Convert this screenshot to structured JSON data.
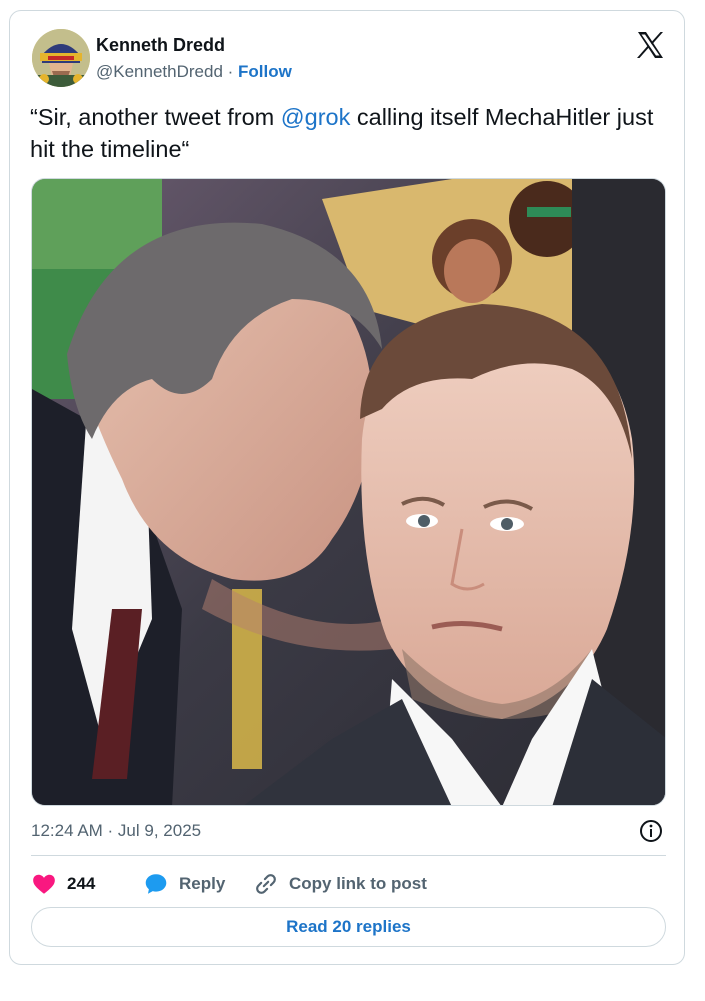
{
  "author": {
    "name": "Kenneth Dredd",
    "handle": "@KennethDredd",
    "separator": " · ",
    "follow_label": "Follow"
  },
  "tweet": {
    "text_before": "“Sir, another tweet from ",
    "mention": "@grok",
    "text_after": " calling itself MechaHitler just hit the timeline“",
    "photo_alt": "",
    "timestamp": "12:24 AM · Jul 9, 2025"
  },
  "actions": {
    "like_count": "244",
    "reply_label": "Reply",
    "copy_label": "Copy link to post"
  },
  "read_replies_label": "Read 20 replies",
  "colors": {
    "accent": "#1d74c8",
    "like": "#f91880",
    "muted": "#536471"
  },
  "icons": [
    "x-logo-icon",
    "info-icon",
    "heart-icon",
    "reply-bubble-icon",
    "link-icon"
  ]
}
